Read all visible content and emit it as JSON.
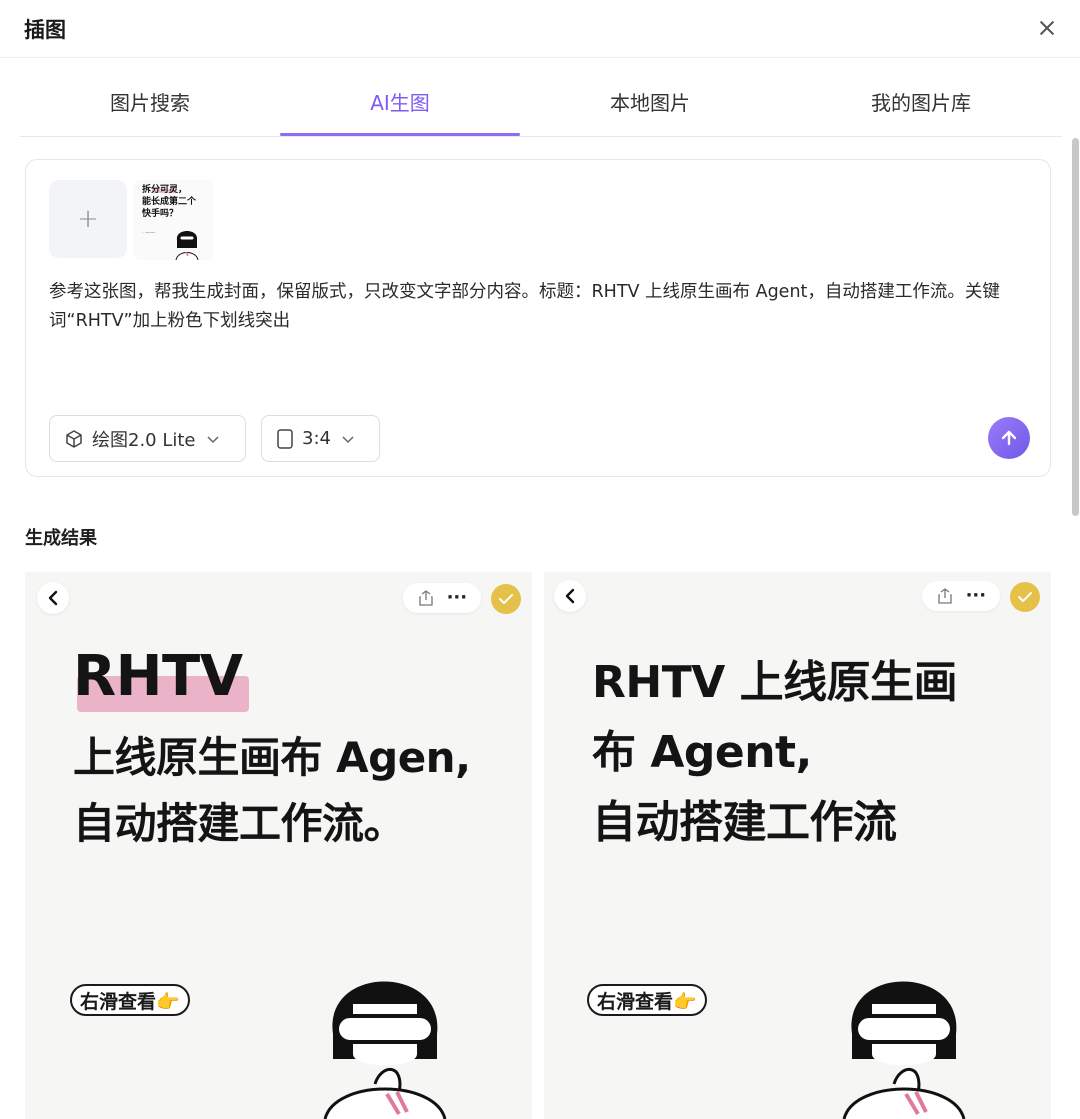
{
  "header": {
    "title": "插图"
  },
  "tabs": [
    {
      "label": "图片搜索",
      "active": false
    },
    {
      "label": "AI生图",
      "active": true
    },
    {
      "label": "本地图片",
      "active": false
    },
    {
      "label": "我的图片库",
      "active": false
    }
  ],
  "composer": {
    "reference_image_text": "拆分可灵，\n能长成第二个\n快手吗？",
    "prompt": "参考这张图，帮我生成封面，保留版式，只改变文字部分内容。标题：RHTV 上线原生画布 Agent，自动搭建工作流。关键词“RHTV”加上粉色下划线突出",
    "model_label": "绘图2.0 Lite",
    "ratio_label": "3:4"
  },
  "results": {
    "title": "生成结果",
    "items": [
      {
        "lines": [
          "RHTV",
          "上线原生画布 Agen,",
          "自动搭建工作流。"
        ],
        "swipe_label": "右滑查看👉"
      },
      {
        "lines": [
          "RHTV 上线原生画",
          "布 Agent,",
          "自动搭建工作流"
        ],
        "swipe_label": "右滑查看👉"
      }
    ]
  },
  "colors": {
    "accent": "#7c5cf3",
    "highlight": "#e8a7c0",
    "check": "#e6c14a"
  }
}
